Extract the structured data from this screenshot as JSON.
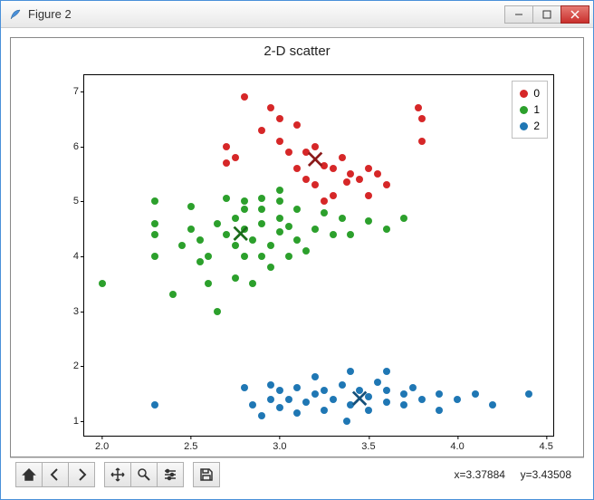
{
  "window": {
    "title": "Figure 2"
  },
  "toolbar": {
    "coord_label_x": "x=3.37884",
    "coord_label_y": "y=3.43508"
  },
  "legend": {
    "items": [
      {
        "label": "0",
        "color": "#d62728"
      },
      {
        "label": "1",
        "color": "#2ca02c"
      },
      {
        "label": "2",
        "color": "#1f77b4"
      }
    ]
  },
  "chart_data": {
    "type": "scatter",
    "title": "2-D scatter",
    "xlabel": "",
    "ylabel": "",
    "xlim": [
      1.9,
      4.55
    ],
    "ylim": [
      0.7,
      7.3
    ],
    "xticks": [
      2.0,
      2.5,
      3.0,
      3.5,
      4.0,
      4.5
    ],
    "yticks": [
      1,
      2,
      3,
      4,
      5,
      6,
      7
    ],
    "centroids": [
      {
        "series": "0",
        "x": 3.2,
        "y": 5.75
      },
      {
        "series": "1",
        "x": 2.78,
        "y": 4.4
      },
      {
        "series": "2",
        "x": 3.45,
        "y": 1.4
      }
    ],
    "series": [
      {
        "name": "0",
        "color": "#d62728",
        "points": [
          [
            2.8,
            6.9
          ],
          [
            2.9,
            6.3
          ],
          [
            2.95,
            6.7
          ],
          [
            3.0,
            6.1
          ],
          [
            3.05,
            5.9
          ],
          [
            3.0,
            6.5
          ],
          [
            3.1,
            6.4
          ],
          [
            3.1,
            5.6
          ],
          [
            3.15,
            5.4
          ],
          [
            3.15,
            5.9
          ],
          [
            3.2,
            6.0
          ],
          [
            3.2,
            5.3
          ],
          [
            3.25,
            5.65
          ],
          [
            3.25,
            5.0
          ],
          [
            3.3,
            5.1
          ],
          [
            3.3,
            5.6
          ],
          [
            3.35,
            5.8
          ],
          [
            3.38,
            5.35
          ],
          [
            3.4,
            5.5
          ],
          [
            3.45,
            5.4
          ],
          [
            3.5,
            5.6
          ],
          [
            3.5,
            5.1
          ],
          [
            3.55,
            5.5
          ],
          [
            3.6,
            5.3
          ],
          [
            3.8,
            6.1
          ],
          [
            3.78,
            6.7
          ],
          [
            3.8,
            6.5
          ],
          [
            2.7,
            5.7
          ],
          [
            2.7,
            6.0
          ],
          [
            2.75,
            5.8
          ]
        ]
      },
      {
        "name": "1",
        "color": "#2ca02c",
        "points": [
          [
            2.0,
            3.5
          ],
          [
            2.3,
            4.0
          ],
          [
            2.3,
            4.4
          ],
          [
            2.3,
            4.6
          ],
          [
            2.3,
            5.0
          ],
          [
            2.4,
            3.3
          ],
          [
            2.45,
            4.2
          ],
          [
            2.5,
            4.5
          ],
          [
            2.5,
            4.9
          ],
          [
            2.55,
            3.9
          ],
          [
            2.55,
            4.3
          ],
          [
            2.6,
            3.5
          ],
          [
            2.6,
            4.0
          ],
          [
            2.65,
            3.0
          ],
          [
            2.65,
            4.6
          ],
          [
            2.7,
            4.4
          ],
          [
            2.7,
            5.05
          ],
          [
            2.75,
            3.6
          ],
          [
            2.75,
            4.2
          ],
          [
            2.75,
            4.7
          ],
          [
            2.8,
            4.0
          ],
          [
            2.8,
            4.5
          ],
          [
            2.8,
            4.85
          ],
          [
            2.8,
            5.0
          ],
          [
            2.85,
            3.5
          ],
          [
            2.85,
            4.3
          ],
          [
            2.9,
            4.0
          ],
          [
            2.9,
            4.6
          ],
          [
            2.9,
            4.85
          ],
          [
            2.9,
            5.05
          ],
          [
            2.95,
            3.8
          ],
          [
            2.95,
            4.2
          ],
          [
            3.0,
            4.45
          ],
          [
            3.0,
            4.7
          ],
          [
            3.0,
            5.0
          ],
          [
            3.0,
            5.2
          ],
          [
            3.05,
            4.0
          ],
          [
            3.05,
            4.55
          ],
          [
            3.1,
            4.3
          ],
          [
            3.1,
            4.85
          ],
          [
            3.15,
            4.1
          ],
          [
            3.2,
            4.5
          ],
          [
            3.25,
            4.8
          ],
          [
            3.3,
            4.4
          ],
          [
            3.35,
            4.7
          ],
          [
            3.4,
            4.4
          ],
          [
            3.5,
            4.65
          ],
          [
            3.6,
            4.5
          ],
          [
            3.7,
            4.7
          ]
        ]
      },
      {
        "name": "2",
        "color": "#1f77b4",
        "points": [
          [
            2.3,
            1.3
          ],
          [
            2.8,
            1.6
          ],
          [
            2.85,
            1.3
          ],
          [
            2.9,
            1.1
          ],
          [
            2.95,
            1.4
          ],
          [
            2.95,
            1.65
          ],
          [
            3.0,
            1.25
          ],
          [
            3.0,
            1.55
          ],
          [
            3.05,
            1.4
          ],
          [
            3.1,
            1.15
          ],
          [
            3.1,
            1.6
          ],
          [
            3.15,
            1.35
          ],
          [
            3.2,
            1.5
          ],
          [
            3.2,
            1.8
          ],
          [
            3.25,
            1.2
          ],
          [
            3.25,
            1.55
          ],
          [
            3.3,
            1.4
          ],
          [
            3.35,
            1.65
          ],
          [
            3.38,
            1.0
          ],
          [
            3.4,
            1.3
          ],
          [
            3.4,
            1.9
          ],
          [
            3.45,
            1.55
          ],
          [
            3.5,
            1.2
          ],
          [
            3.5,
            1.45
          ],
          [
            3.55,
            1.7
          ],
          [
            3.6,
            1.35
          ],
          [
            3.6,
            1.55
          ],
          [
            3.6,
            1.9
          ],
          [
            3.7,
            1.3
          ],
          [
            3.7,
            1.5
          ],
          [
            3.75,
            1.6
          ],
          [
            3.8,
            1.4
          ],
          [
            3.9,
            1.2
          ],
          [
            3.9,
            1.5
          ],
          [
            4.0,
            1.4
          ],
          [
            4.1,
            1.5
          ],
          [
            4.2,
            1.3
          ],
          [
            4.4,
            1.5
          ]
        ]
      }
    ]
  }
}
